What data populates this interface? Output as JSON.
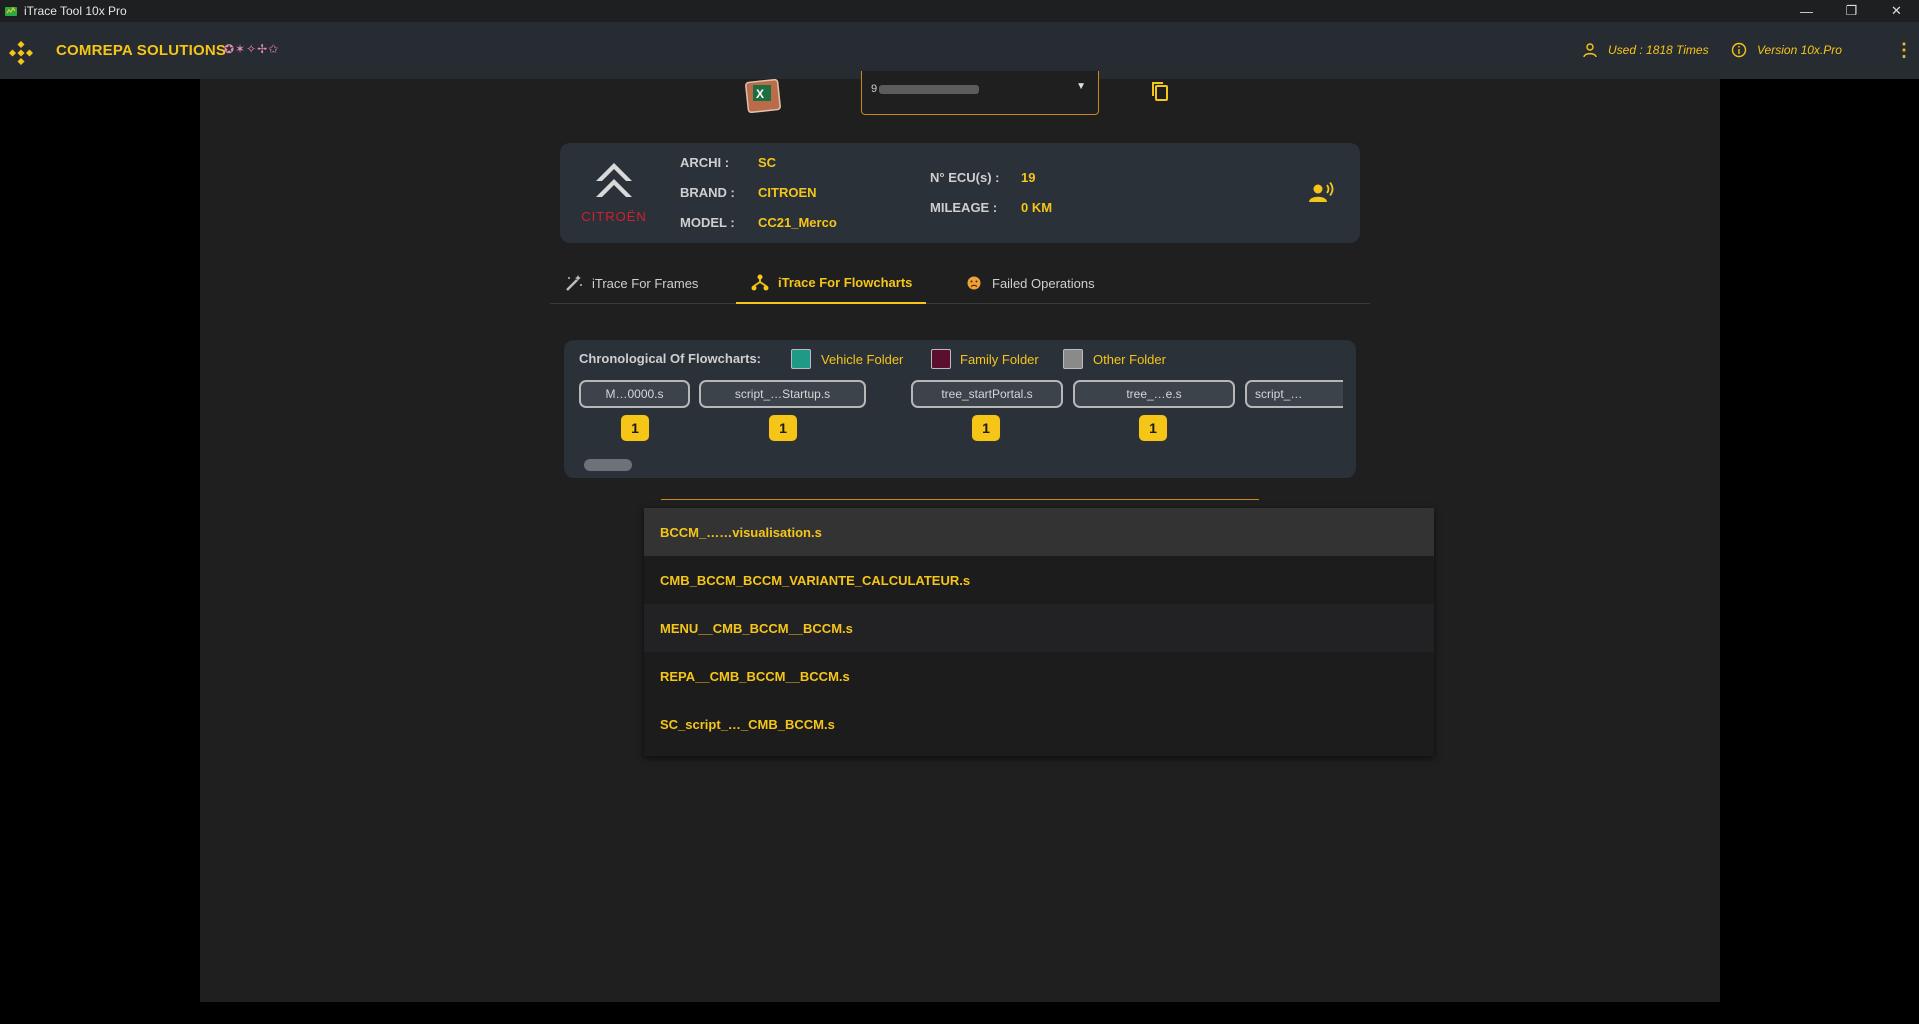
{
  "window": {
    "title": "iTrace Tool 10x Pro",
    "buttons": [
      "—",
      "❐",
      "✕"
    ]
  },
  "header": {
    "brand": "COMREPA SOLUTIONS",
    "brand_deco": "✪✶✧✢✩",
    "used": "Used : 1818 Times",
    "version": "Version 10x.Pro",
    "menu": "⋮",
    "accent": "#f5c518"
  },
  "top_select": {
    "value": "9"
  },
  "vehicle": {
    "archi_label": "ARCHI :",
    "archi": "SC",
    "brand_label": "BRAND :",
    "brand": "CITROEN",
    "model_label": "MODEL :",
    "model": "CC21_Merco",
    "ecu_label": "N° ECU(s) :",
    "ecu": "19",
    "mileage_label": "MILEAGE :",
    "mileage": "0 KM",
    "logo_text": "CITROËN"
  },
  "tabs": [
    {
      "label": "iTrace For Frames"
    },
    {
      "label": "iTrace For Flowcharts"
    },
    {
      "label": "Failed Operations"
    }
  ],
  "flowcharts": {
    "heading": "Chronological Of Flowcharts:",
    "legend": [
      {
        "label": "Vehicle Folder",
        "color": "#1f9a86"
      },
      {
        "label": "Family Folder",
        "color": "#5a0f2e"
      },
      {
        "label": "Other Folder",
        "color": "#8a8a8a"
      }
    ],
    "chips": [
      {
        "label": "M…0000.s",
        "count": "1"
      },
      {
        "label": "script_…Startup.s",
        "count": "1"
      },
      {
        "label": "tree_startPortal.s",
        "count": "1"
      },
      {
        "label": "tree_…e.s",
        "count": "1"
      },
      {
        "label": "script_…",
        "count": ""
      }
    ]
  },
  "dropdown": {
    "items": [
      "BCCM_……visualisation.s",
      "CMB_BCCM_BCCM_VARIANTE_CALCULATEUR.s",
      "MENU__CMB_BCCM__BCCM.s",
      "REPA__CMB_BCCM__BCCM.s",
      "SC_script_…_CMB_BCCM.s"
    ]
  }
}
